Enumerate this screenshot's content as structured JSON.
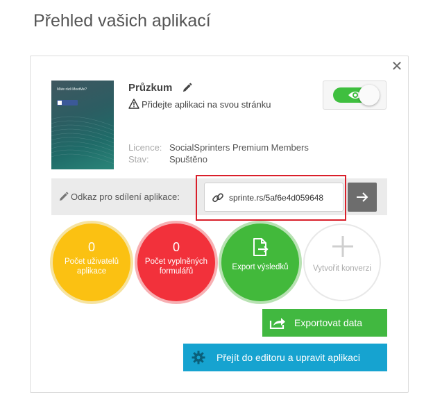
{
  "page": {
    "title": "Přehled vašich aplikací",
    "close_icon": "close-icon",
    "colors": {
      "highlight_border": "#d91f2a",
      "toggle_on": "#3fbf3f",
      "users": "#fbc112",
      "forms": "#f2313b",
      "export": "#42b93b",
      "editor_button": "#16a3d0",
      "export_button": "#41b840"
    }
  },
  "app": {
    "name": "Průzkum",
    "edit_icon": "pencil-icon",
    "warning": "Přidejte aplikaci na svou stránku",
    "warning_icon": "warning-triangle-icon",
    "enabled": true,
    "toggle_icon": "eye-icon",
    "thumbnail": {
      "question": "Máte rádi MeetMe?"
    },
    "meta": {
      "licence_label": "Licence:",
      "licence_value": "SocialSprinters Premium Members",
      "status_label": "Stav:",
      "status_value": "Spuštěno"
    }
  },
  "share": {
    "label": "Odkaz pro sdílení aplikace:",
    "url": "sprinte.rs/5af6e4d059648",
    "link_icon": "link-icon",
    "go_icon": "arrow-right-icon"
  },
  "stats": [
    {
      "value": "0",
      "label": "Počet uživatelů aplikace"
    },
    {
      "value": "0",
      "label": "Počet vyplněných formulářů"
    },
    {
      "label": "Export výsledků",
      "icon": "file-export-icon"
    },
    {
      "label": "Vytvořit konverzi",
      "icon": "plus-icon"
    }
  ],
  "actions": {
    "export_data": "Exportovat data",
    "export_icon": "share-box-icon",
    "open_editor": "Přejít do editoru a upravit aplikaci",
    "editor_icon": "gear-icon"
  }
}
